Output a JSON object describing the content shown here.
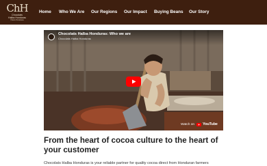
{
  "logo": {
    "mark": "ChH",
    "line1": "Chocolats",
    "line2": "Halba Honduras",
    "line3": "Pakai Ahraskasa"
  },
  "nav": {
    "items": [
      {
        "label": "Home"
      },
      {
        "label": "Who We Are"
      },
      {
        "label": "Our Regions"
      },
      {
        "label": "Our Impact"
      },
      {
        "label": "Buying Beans"
      },
      {
        "label": "Our Story"
      }
    ]
  },
  "video": {
    "title": "Chocolats Halba Honduras: Who we are",
    "channel": "Chocolats Halba Honduras",
    "watch_on_label": "Watch on",
    "youtube_wordmark": "YouTube"
  },
  "main": {
    "headline": "From the heart of cocoa culture to the heart of your customer",
    "body": "Chocolats Halba Honduras is your reliable partner for quality cocoa direct from Honduran farmers"
  },
  "colors": {
    "nav_background": "#3e1f0f",
    "play_button": "#ff0000",
    "headline": "#1f1f1f"
  },
  "icons": {
    "play": "youtube-play-icon",
    "youtube": "youtube-logo-icon"
  }
}
